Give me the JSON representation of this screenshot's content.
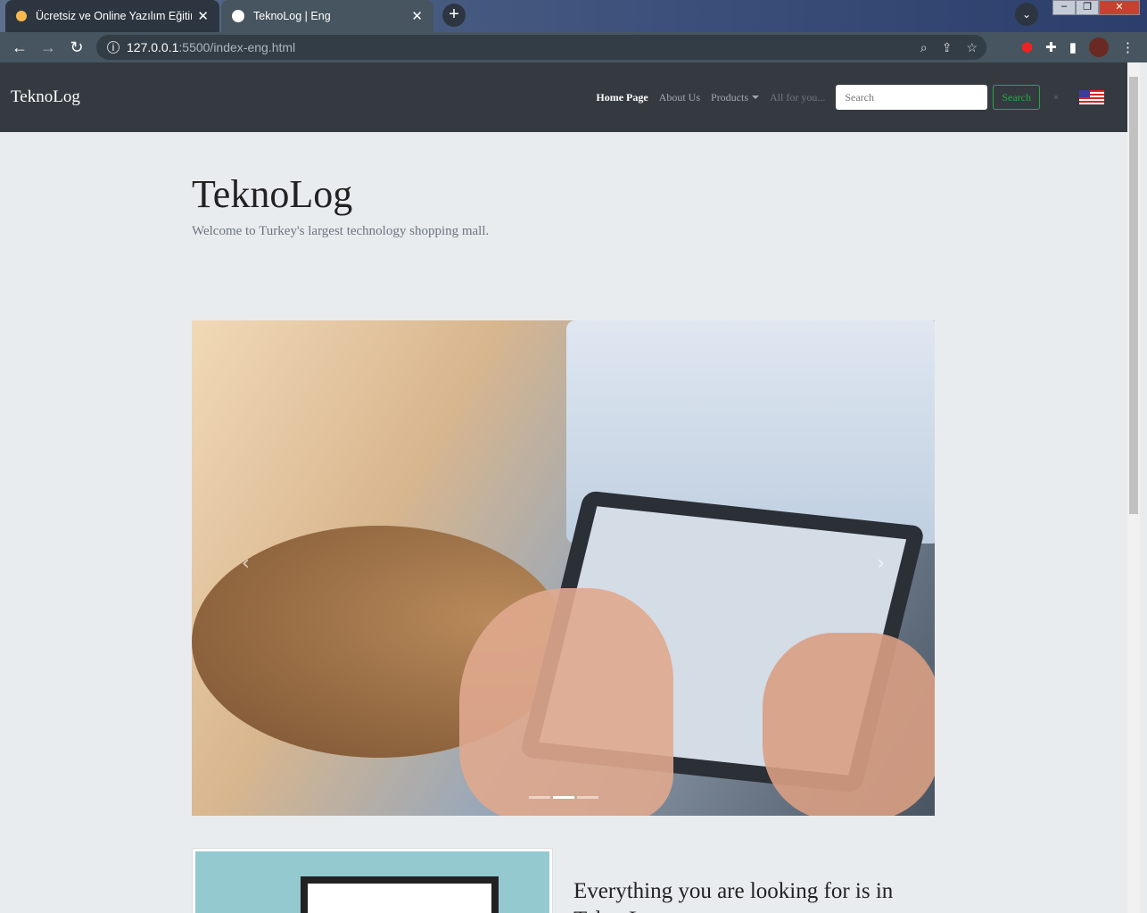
{
  "browser": {
    "tabs": [
      {
        "title": "Ücretsiz ve Online Yazılım Eğitimleri",
        "icon": "orange-dot-icon"
      },
      {
        "title": "TeknoLog | Eng",
        "icon": "globe-icon",
        "active": true
      }
    ],
    "url_host": "127.0.0.1",
    "url_rest": ":5500/index-eng.html"
  },
  "navbar": {
    "brand": "TeknoLog",
    "links": [
      "Home Page",
      "About Us",
      "Products",
      "All for you..."
    ],
    "search_placeholder": "Search",
    "search_button": "Search",
    "language": "English (US flag)"
  },
  "hero": {
    "title": "TeknoLog",
    "subtitle": "Welcome to Turkey's largest technology shopping mall."
  },
  "carousel": {
    "slides": 3,
    "active_slide": 2
  },
  "section": {
    "heading": "Everything you are looking for is in TeknoLog"
  }
}
